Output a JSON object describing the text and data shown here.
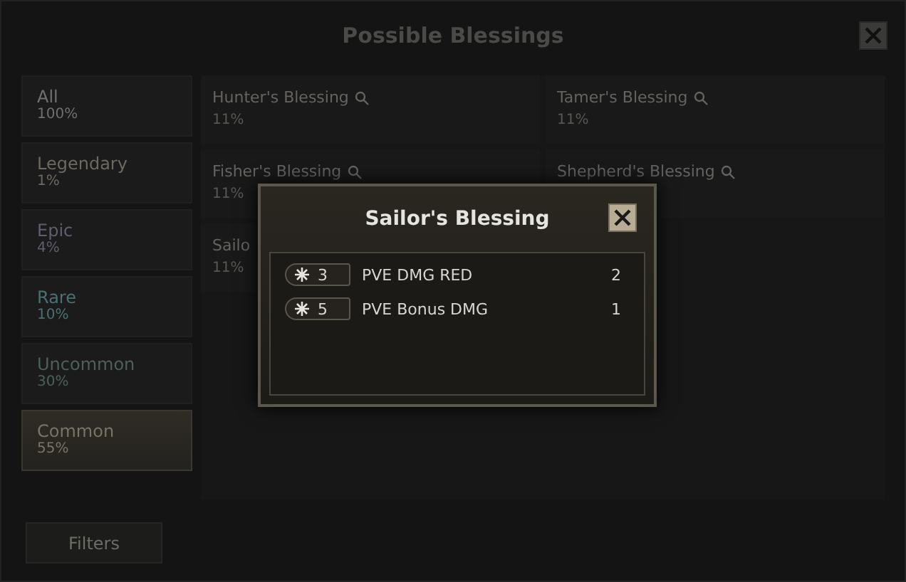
{
  "window": {
    "title": "Possible Blessings"
  },
  "rarities": [
    {
      "name": "All",
      "chance": "100%",
      "color": "#707070",
      "selected": false
    },
    {
      "name": "Legendary",
      "chance": "1%",
      "color": "#6e6960",
      "selected": false
    },
    {
      "name": "Epic",
      "chance": "4%",
      "color": "#5f5f70",
      "selected": false
    },
    {
      "name": "Rare",
      "chance": "10%",
      "color": "#4a7073",
      "selected": false
    },
    {
      "name": "Uncommon",
      "chance": "30%",
      "color": "#4c6158",
      "selected": false
    },
    {
      "name": "Common",
      "chance": "55%",
      "color": "#7a7466",
      "selected": true
    }
  ],
  "filters_button": "Filters",
  "blessings": [
    {
      "name": "Hunter's Blessing",
      "chance": "11%",
      "search": true
    },
    {
      "name": "Tamer's Blessing",
      "chance": "11%",
      "search": true
    },
    {
      "name": "Fisher's Blessing",
      "chance": "11%",
      "search": true
    },
    {
      "name": "Shepherd's Blessing",
      "search": true
    },
    {
      "name": "Sailo",
      "chance": "11%",
      "search": false
    }
  ],
  "dialog": {
    "title": "Sailor's Blessing",
    "effects": [
      {
        "tier": "3",
        "name": "PVE DMG RED",
        "value": "2"
      },
      {
        "tier": "5",
        "name": "PVE Bonus DMG",
        "value": "1"
      }
    ]
  }
}
